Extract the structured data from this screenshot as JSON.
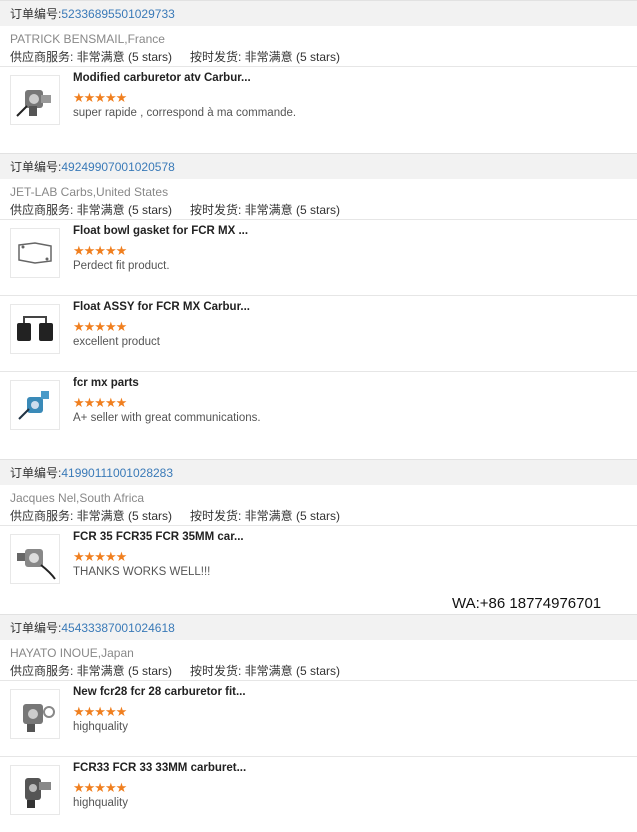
{
  "orders": [
    {
      "label": "订单编号:",
      "number": "52336895501029733",
      "buyer": "PATRICK BENSMAIL,France",
      "service": "供应商服务: 非常满意 (5 stars)",
      "shipping": "按时发货: 非常满意 (5 stars)",
      "items": [
        {
          "title": "Modified carburetor atv Carbur...",
          "stars": "★★★★★",
          "review": "super rapide , correspond à ma commande.",
          "icon": "carburetor-icon"
        }
      ]
    },
    {
      "label": "订单编号:",
      "number": "49249907001020578",
      "buyer": "JET-LAB Carbs,United States",
      "service": "供应商服务: 非常满意 (5 stars)",
      "shipping": "按时发货: 非常满意 (5 stars)",
      "items": [
        {
          "title": "Float bowl gasket for FCR MX ...",
          "stars": "★★★★★",
          "review": "Perdect fit product.",
          "icon": "gasket-icon"
        },
        {
          "title": "Float ASSY for FCR MX Carbur...",
          "stars": "★★★★★",
          "review": "excellent product",
          "icon": "float-icon"
        },
        {
          "title": "fcr mx parts",
          "stars": "★★★★★",
          "review": "A+ seller with great communications.",
          "icon": "carburetor-icon"
        }
      ]
    },
    {
      "label": "订单编号:",
      "number": "41990111001028283",
      "buyer": "Jacques Nel,South Africa",
      "service": "供应商服务: 非常满意 (5 stars)",
      "shipping": "按时发货: 非常满意 (5 stars)",
      "items": [
        {
          "title": "FCR 35 FCR35 FCR 35MM car...",
          "stars": "★★★★★",
          "review": "THANKS WORKS WELL!!!",
          "icon": "carburetor-icon"
        }
      ]
    },
    {
      "label": "订单编号:",
      "number": "45433387001024618",
      "buyer": "HAYATO INOUE,Japan",
      "service": "供应商服务: 非常满意 (5 stars)",
      "shipping": "按时发货: 非常满意 (5 stars)",
      "items": [
        {
          "title": "New fcr28 fcr 28 carburetor fit...",
          "stars": "★★★★★",
          "review": "highquality",
          "icon": "carburetor-icon"
        },
        {
          "title": "FCR33 FCR 33 33MM carburet...",
          "stars": "★★★★★",
          "review": "highquality",
          "icon": "carburetor-icon"
        }
      ]
    }
  ],
  "watermark": "WA:+86 18774976701",
  "colors": {
    "link": "#3a7ab8",
    "star": "#f07f1f",
    "header_bg": "#f2f2f2"
  }
}
